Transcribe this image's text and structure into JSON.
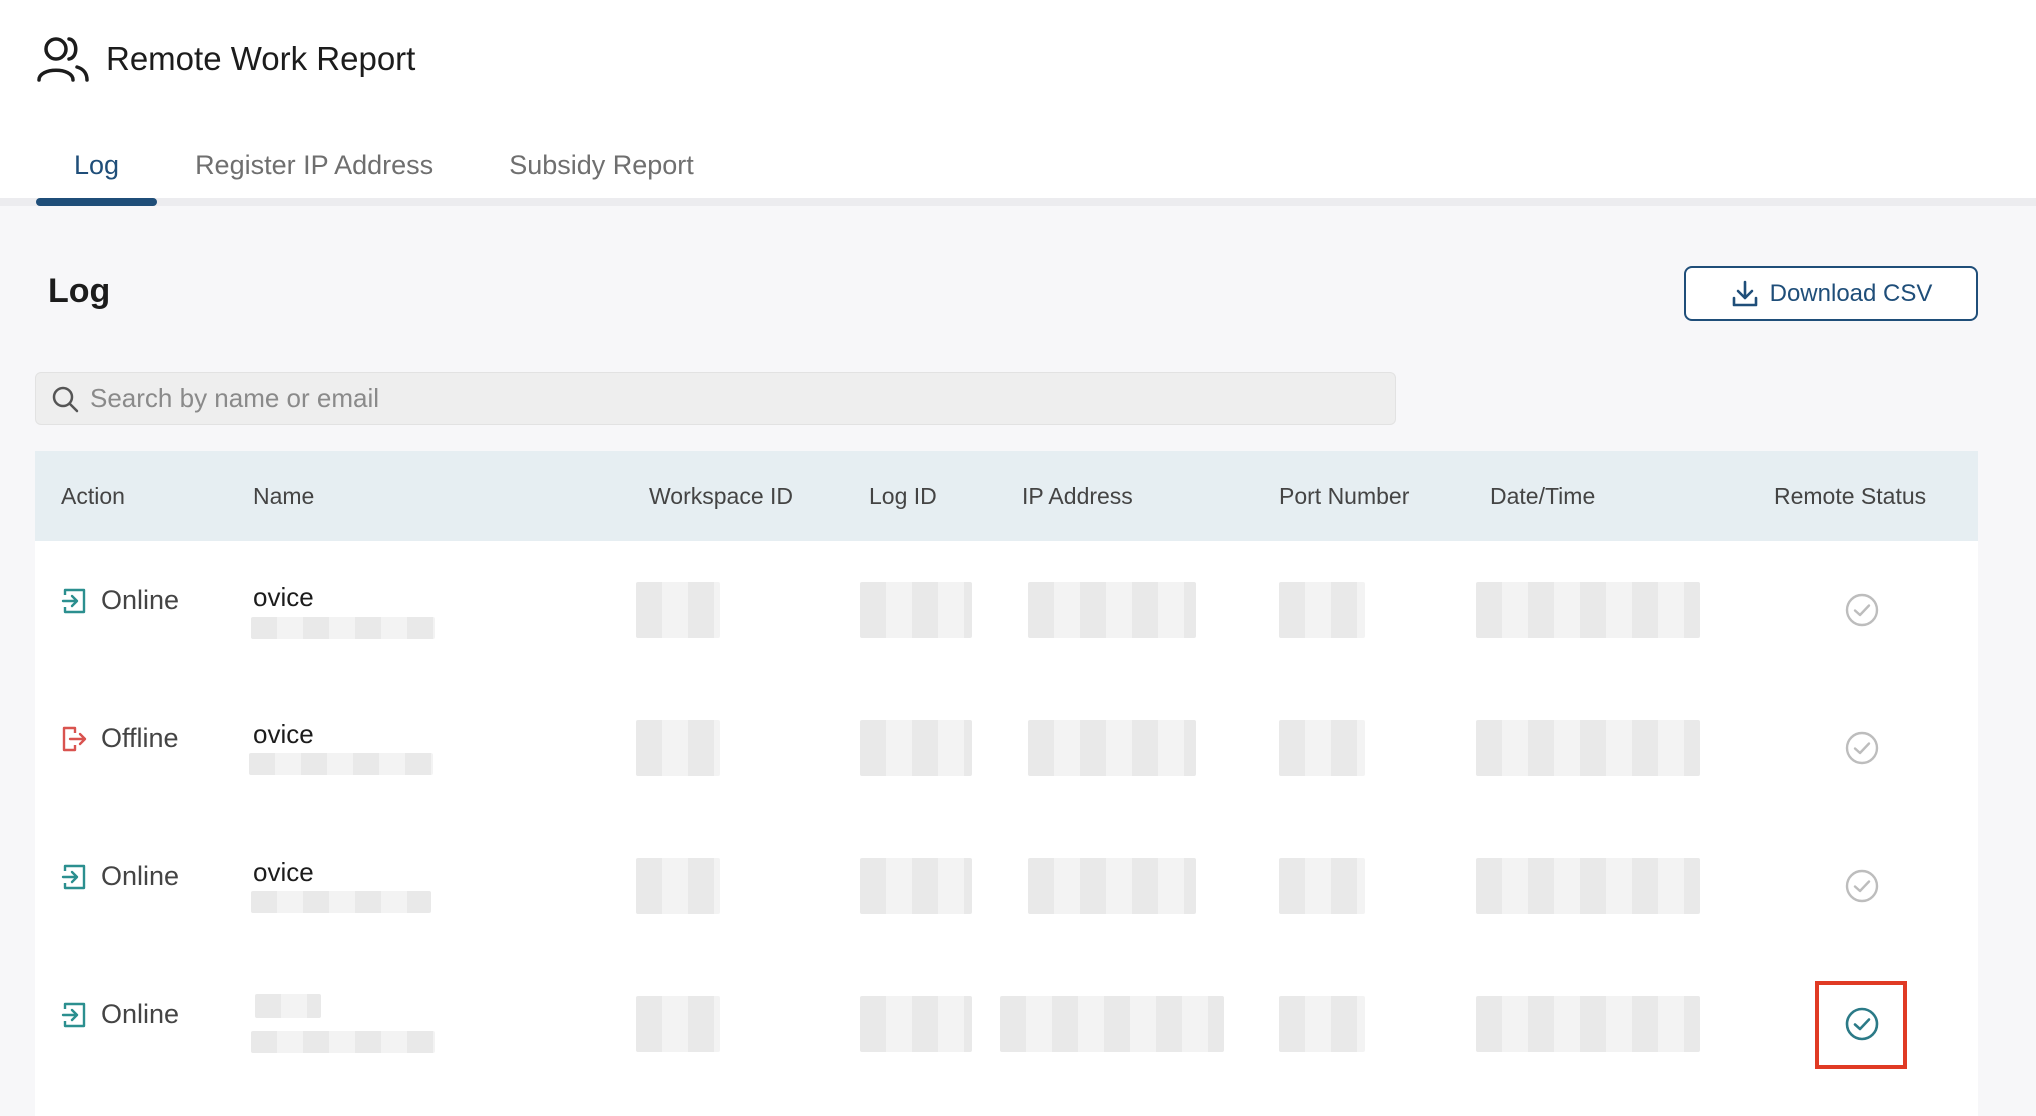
{
  "app": {
    "title": "Remote Work Report",
    "icon": "users-icon"
  },
  "tabs": [
    {
      "label": "Log",
      "active": true
    },
    {
      "label": "Register IP Address",
      "active": false
    },
    {
      "label": "Subsidy Report",
      "active": false
    }
  ],
  "section": {
    "title": "Log"
  },
  "toolbar": {
    "download_label": "Download CSV",
    "download_icon": "download-icon"
  },
  "search": {
    "placeholder": "Search by name or email",
    "value": ""
  },
  "table": {
    "columns": [
      "Action",
      "Name",
      "Workspace ID",
      "Log ID",
      "IP Address",
      "Port Number",
      "Date/Time",
      "Remote Status"
    ],
    "rows": [
      {
        "action": "Online",
        "action_icon": "login-icon",
        "name": "ovice",
        "status": "confirmed",
        "status_color": "#bdbdbd"
      },
      {
        "action": "Offline",
        "action_icon": "logout-icon",
        "name": "ovice",
        "status": "confirmed",
        "status_color": "#bdbdbd"
      },
      {
        "action": "Online",
        "action_icon": "login-icon",
        "name": "ovice",
        "status": "confirmed",
        "status_color": "#bdbdbd"
      },
      {
        "action": "Online",
        "action_icon": "login-icon",
        "name": "",
        "status": "confirmed",
        "status_color": "#2b7a87",
        "highlighted": true
      }
    ]
  },
  "colors": {
    "accent": "#1f4e79",
    "online": "#2b8f8f",
    "offline": "#d9534f",
    "highlight": "#e03a24"
  }
}
